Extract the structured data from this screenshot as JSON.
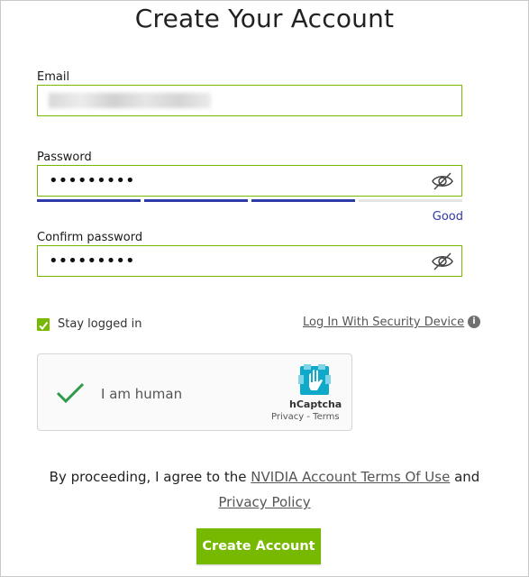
{
  "page": {
    "title": "Create Your Account"
  },
  "form": {
    "email_label": "Email",
    "password_label": "Password",
    "password_value": "•••••••••",
    "confirm_label": "Confirm password",
    "confirm_value": "•••••••••",
    "strength_text": "Good",
    "strength_level_segments_filled": 3,
    "strength_segments_total": 4
  },
  "options": {
    "stay_logged_in_label": "Stay logged in",
    "stay_logged_in_checked": true,
    "security_device_link": "Log In With Security Device"
  },
  "captcha": {
    "label": "I am human",
    "brand": "hCaptcha",
    "links": "Privacy - Terms"
  },
  "agreement": {
    "prefix": "By proceeding, I agree to the ",
    "terms_link": "NVIDIA Account Terms Of Use",
    "middle": " and",
    "privacy_link": "Privacy Policy"
  },
  "submit_label": "Create Account",
  "colors": {
    "accent": "#76b900",
    "strength_bar": "#2d3aa8",
    "strength_text": "#2d3aa8"
  },
  "icons": [
    "eye-slash-icon",
    "info-icon",
    "checkmark-icon",
    "hcaptcha-logo-icon"
  ]
}
